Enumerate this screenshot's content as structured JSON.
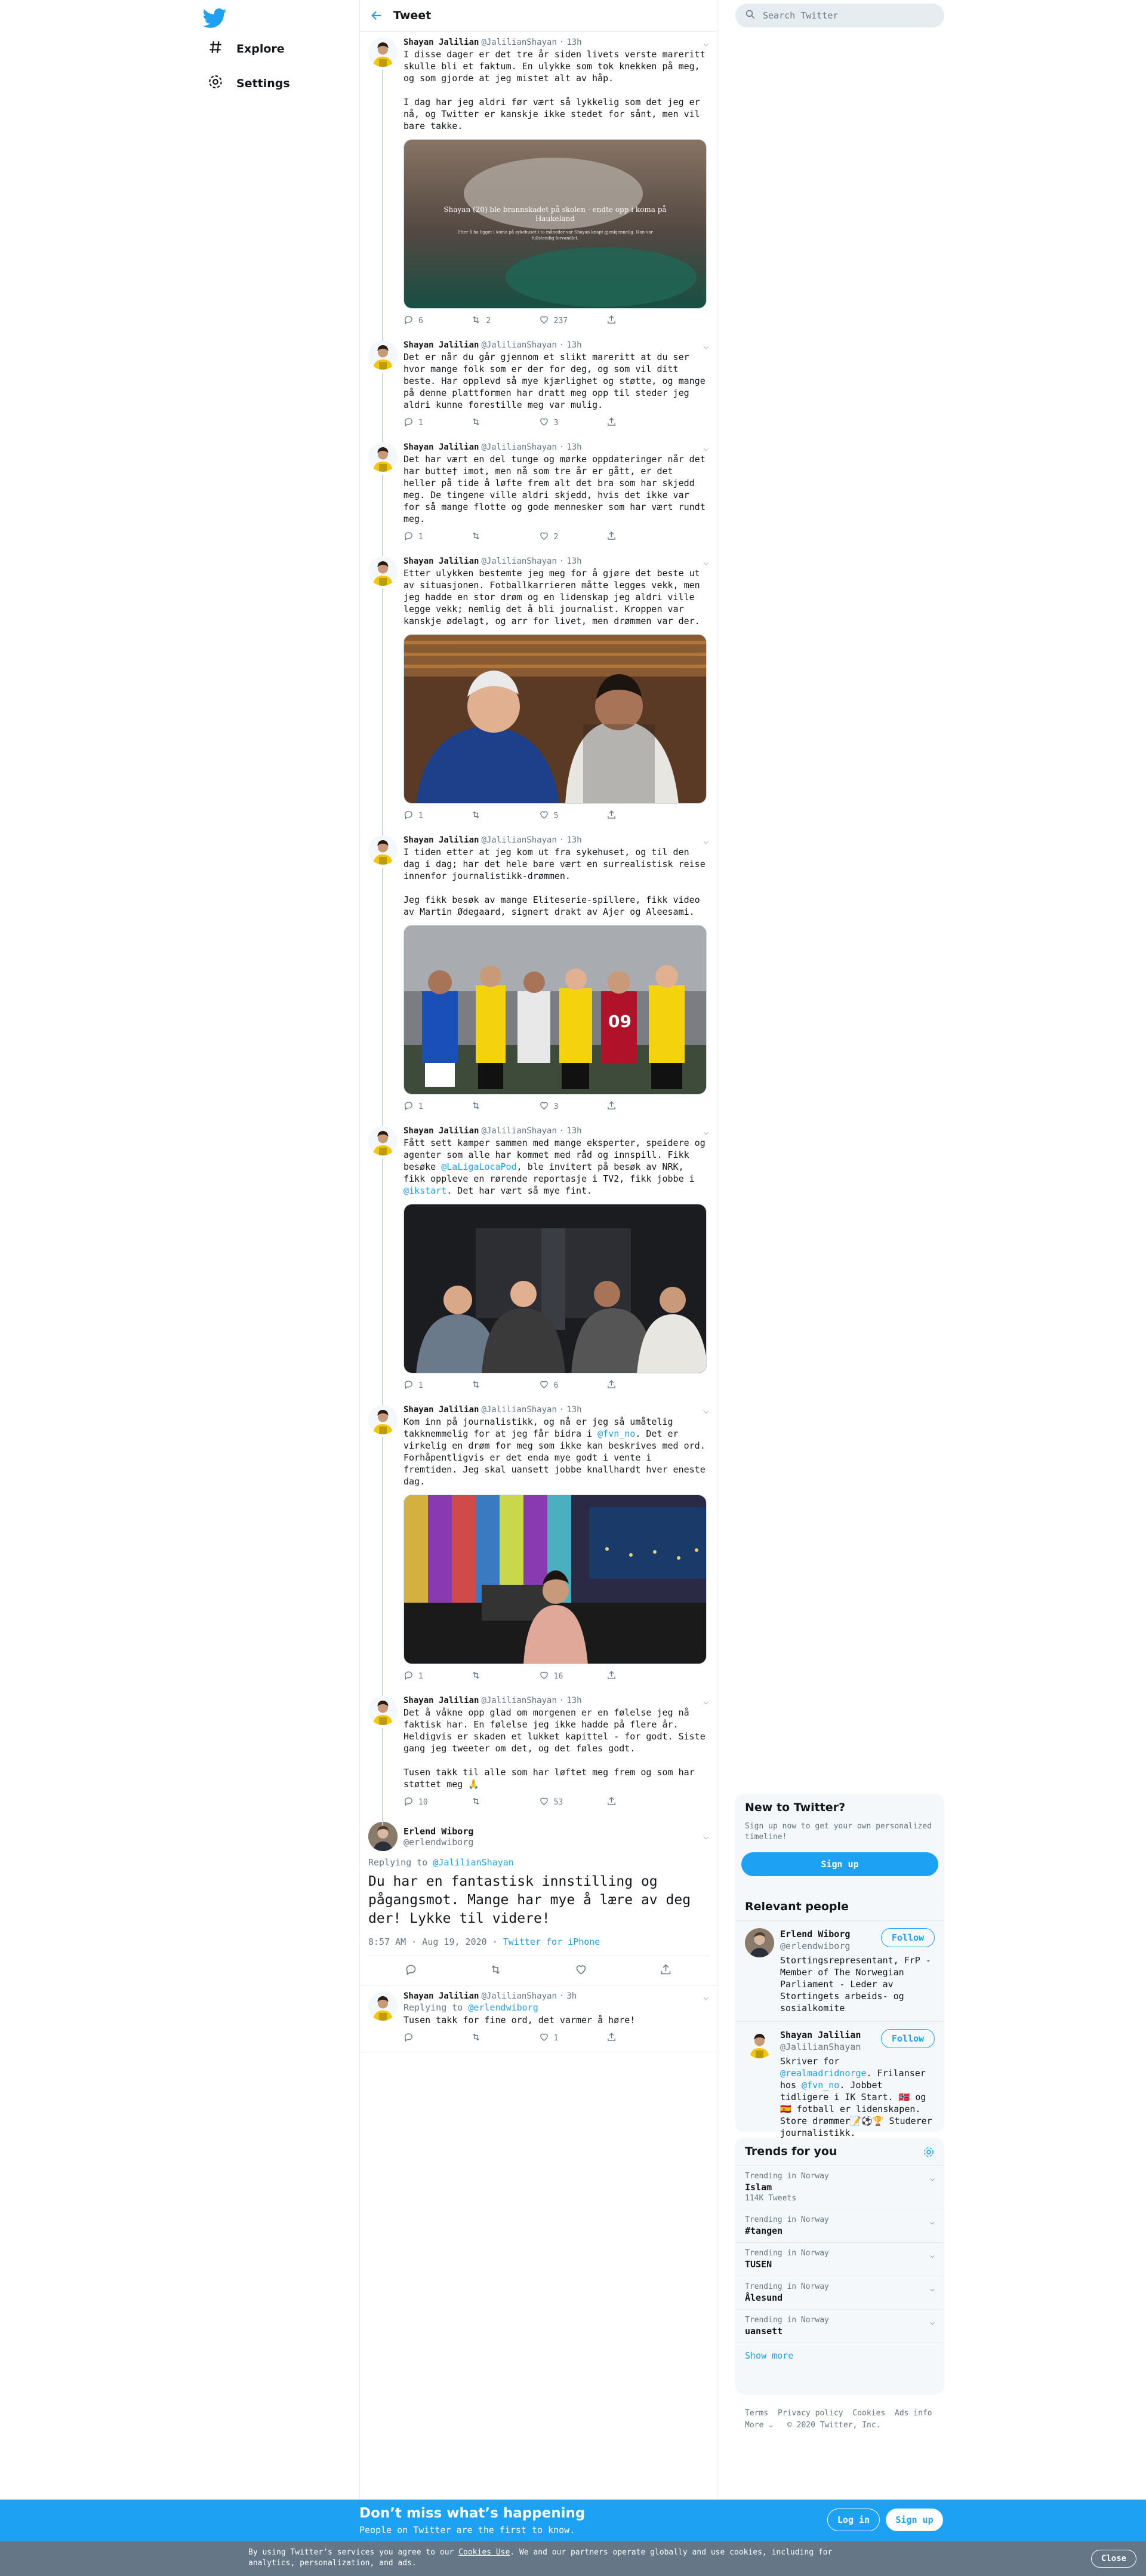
{
  "nav": {
    "explore": "Explore",
    "settings": "Settings"
  },
  "header": {
    "title": "Tweet"
  },
  "search": {
    "placeholder": "Search Twitter"
  },
  "thread": [
    {
      "name": "Shayan Jalilian",
      "handle": "@JalilianShayan",
      "time": "13h",
      "text": "I disse dager er det tre år siden livets verste mareritt skulle bli et faktum. En ulykke som tok knekken på meg, og som gjorde at jeg mistet alt av håp.\n\nI dag har jeg aldri før vært så lykkelig som det jeg er nå, og Twitter er kanskje ikke stedet for sånt, men vil bare takke.",
      "media_caption": "Shayan (20) ble brannskadet på skolen - endte opp i koma på Haukeland",
      "media_sub": "Etter å ha ligget i koma på sykehuset i to måneder var Shayan knapt gjenkjennelig. Han var fullstendig forvandlet.",
      "media": "hospital",
      "replies": "6",
      "retweets": "2",
      "likes": "237"
    },
    {
      "name": "Shayan Jalilian",
      "handle": "@JalilianShayan",
      "time": "13h",
      "text": "Det er når du går gjennom et slikt mareritt at du ser hvor mange folk som er der for deg, og som vil ditt beste. Har opplevd så mye kjærlighet og støtte, og mange på denne plattformen har dratt meg opp til steder jeg aldri kunne forestille meg var mulig.",
      "media": "",
      "replies": "1",
      "retweets": "",
      "likes": "3"
    },
    {
      "name": "Shayan Jalilian",
      "handle": "@JalilianShayan",
      "time": "13h",
      "text": "Det har vært en del tunge og mørke oppdateringer når det har butte† imot, men nå som tre år er gått, er det heller på tide å løfte frem alt det bra som har skjedd meg. De tingene ville aldri skjedd, hvis det ikke var for så mange flotte og gode mennesker som har vært rundt meg.",
      "media": "",
      "replies": "1",
      "retweets": "",
      "likes": "2"
    },
    {
      "name": "Shayan Jalilian",
      "handle": "@JalilianShayan",
      "time": "13h",
      "text": "Etter ulykken bestemte jeg meg for å gjøre det beste ut av situasjonen. Fotballkarrieren måtte legges vekk, men jeg hadde en stor drøm og en lidenskap jeg aldri ville legge vekk; nemlig det å bli journalist. Kroppen var kanskje ødelagt, og arr for livet, men drømmen var der.",
      "media": "coach",
      "replies": "1",
      "retweets": "",
      "likes": "5"
    },
    {
      "name": "Shayan Jalilian",
      "handle": "@JalilianShayan",
      "time": "13h",
      "text": "I tiden etter at jeg kom ut fra sykehuset, og til den dag i dag; har det hele bare vært en surrealistisk reise innenfor journalistikk-drømmen.\n\nJeg fikk besøk av mange Eliteserie-spillere, fikk video av Martin Ødegaard, signert drakt av Ajer og Aleesami.",
      "media": "players",
      "replies": "1",
      "retweets": "",
      "likes": "3"
    },
    {
      "name": "Shayan Jalilian",
      "handle": "@JalilianShayan",
      "time": "13h",
      "text_parts": [
        "Fått sett kamper sammen med mange eksperter, speidere og agenter som alle har kommet med råd og innspill. Fikk besøke ",
        "@LaLigaLocaPod",
        ", ble invitert på besøk av NRK, fikk oppleve en rørende reportasje i TV2, fikk jobbe i ",
        "@ikstart",
        ". Det har vært så mye fint."
      ],
      "media": "studio",
      "replies": "1",
      "retweets": "",
      "likes": "6"
    },
    {
      "name": "Shayan Jalilian",
      "handle": "@JalilianShayan",
      "time": "13h",
      "text_parts": [
        "Kom inn på journalistikk, og nå er jeg så umåtelig takknemmelig for at jeg får bidra i ",
        "@fvn_no",
        ". Det er virkelig en drøm for meg som ikke kan beskrives med ord. Forhåpentligvis er det enda mye godt i vente i fremtiden. Jeg skal uansett jobbe knallhardt hver eneste dag."
      ],
      "media": "newsroom",
      "replies": "1",
      "retweets": "",
      "likes": "16"
    },
    {
      "name": "Shayan Jalilian",
      "handle": "@JalilianShayan",
      "time": "13h",
      "text": "Det å våkne opp glad om morgenen er en følelse jeg nå faktisk har. En følelse jeg ikke hadde på flere år. Heldigvis er skaden et lukket kapittel - for godt. Siste gang jeg tweeter om det, og det føles godt.\n\nTusen takk til alle som har løftet meg frem og som har støttet meg 🙏",
      "media": "",
      "replies": "10",
      "retweets": "",
      "likes": "53"
    }
  ],
  "focus": {
    "name": "Erlend Wiborg",
    "handle": "@erlendwiborg",
    "replying_label": "Replying to",
    "replying_to": "@JalilianShayan",
    "text": "Du har en fantastisk innstilling og pågangsmot. Mange har mye å lære av deg der! Lykke til videre!",
    "timestamp": "8:57 AM · Aug 19, 2020 · ",
    "source": "Twitter for iPhone"
  },
  "reply": {
    "name": "Shayan Jalilian",
    "handle": "@JalilianShayan",
    "time": "3h",
    "replying_label": "Replying to",
    "replying_to": "@erlendwiborg",
    "text": "Tusen takk for fine ord, det varmer å høre!",
    "replies": "",
    "retweets": "",
    "likes": "1"
  },
  "new_to_twitter": {
    "title": "New to Twitter?",
    "sub": "Sign up now to get your own personalized timeline!",
    "button": "Sign up"
  },
  "relevant": {
    "title": "Relevant people",
    "follow": "Follow",
    "people": [
      {
        "name": "Erlend Wiborg",
        "handle": "@erlendwiborg",
        "bio": "Stortingsrepresentant, FrP - Member of The Norwegian Parliament - Leder av Stortingets arbeids- og sosialkomite"
      },
      {
        "name": "Shayan Jalilian",
        "handle": "@JalilianShayan",
        "bio_parts": [
          "Skriver for ",
          "@realmadridnorge",
          ". Frilanser hos ",
          "@fvn_no",
          ". Jobbet tidligere i IK Start. 🇳🇴 og 🇪🇸 fotball er lidenskapen. Store drømmer📝⚽🏆 Studerer journalistikk."
        ]
      }
    ]
  },
  "trends": {
    "title": "Trends for you",
    "items": [
      {
        "context": "Trending in Norway",
        "name": "Islam",
        "count": "114K Tweets"
      },
      {
        "context": "Trending in Norway",
        "name": "#tangen",
        "count": ""
      },
      {
        "context": "Trending in Norway",
        "name": "TUSEN",
        "count": ""
      },
      {
        "context": "Trending in Norway",
        "name": "Ålesund",
        "count": ""
      },
      {
        "context": "Trending in Norway",
        "name": "uansett",
        "count": ""
      }
    ],
    "show_more": "Show more"
  },
  "footer": {
    "links": [
      "Terms",
      "Privacy policy",
      "Cookies",
      "Ads info"
    ],
    "more": "More",
    "copyright": "© 2020 Twitter, Inc."
  },
  "banner": {
    "headline": "Don’t miss what’s happening",
    "sub": "People on Twitter are the first to know.",
    "login": "Log in",
    "signup": "Sign up"
  },
  "cookie": {
    "pre": "By using Twitter’s services you agree to our ",
    "link": "Cookies Use",
    "post": ". We and our partners operate globally and use cookies, including for analytics, personalization, and ads.",
    "close": "Close"
  },
  "colors": {
    "accent": "#1da1f2",
    "border": "#e6ecf0",
    "muted": "#657786",
    "like_active": "#e0245e"
  }
}
